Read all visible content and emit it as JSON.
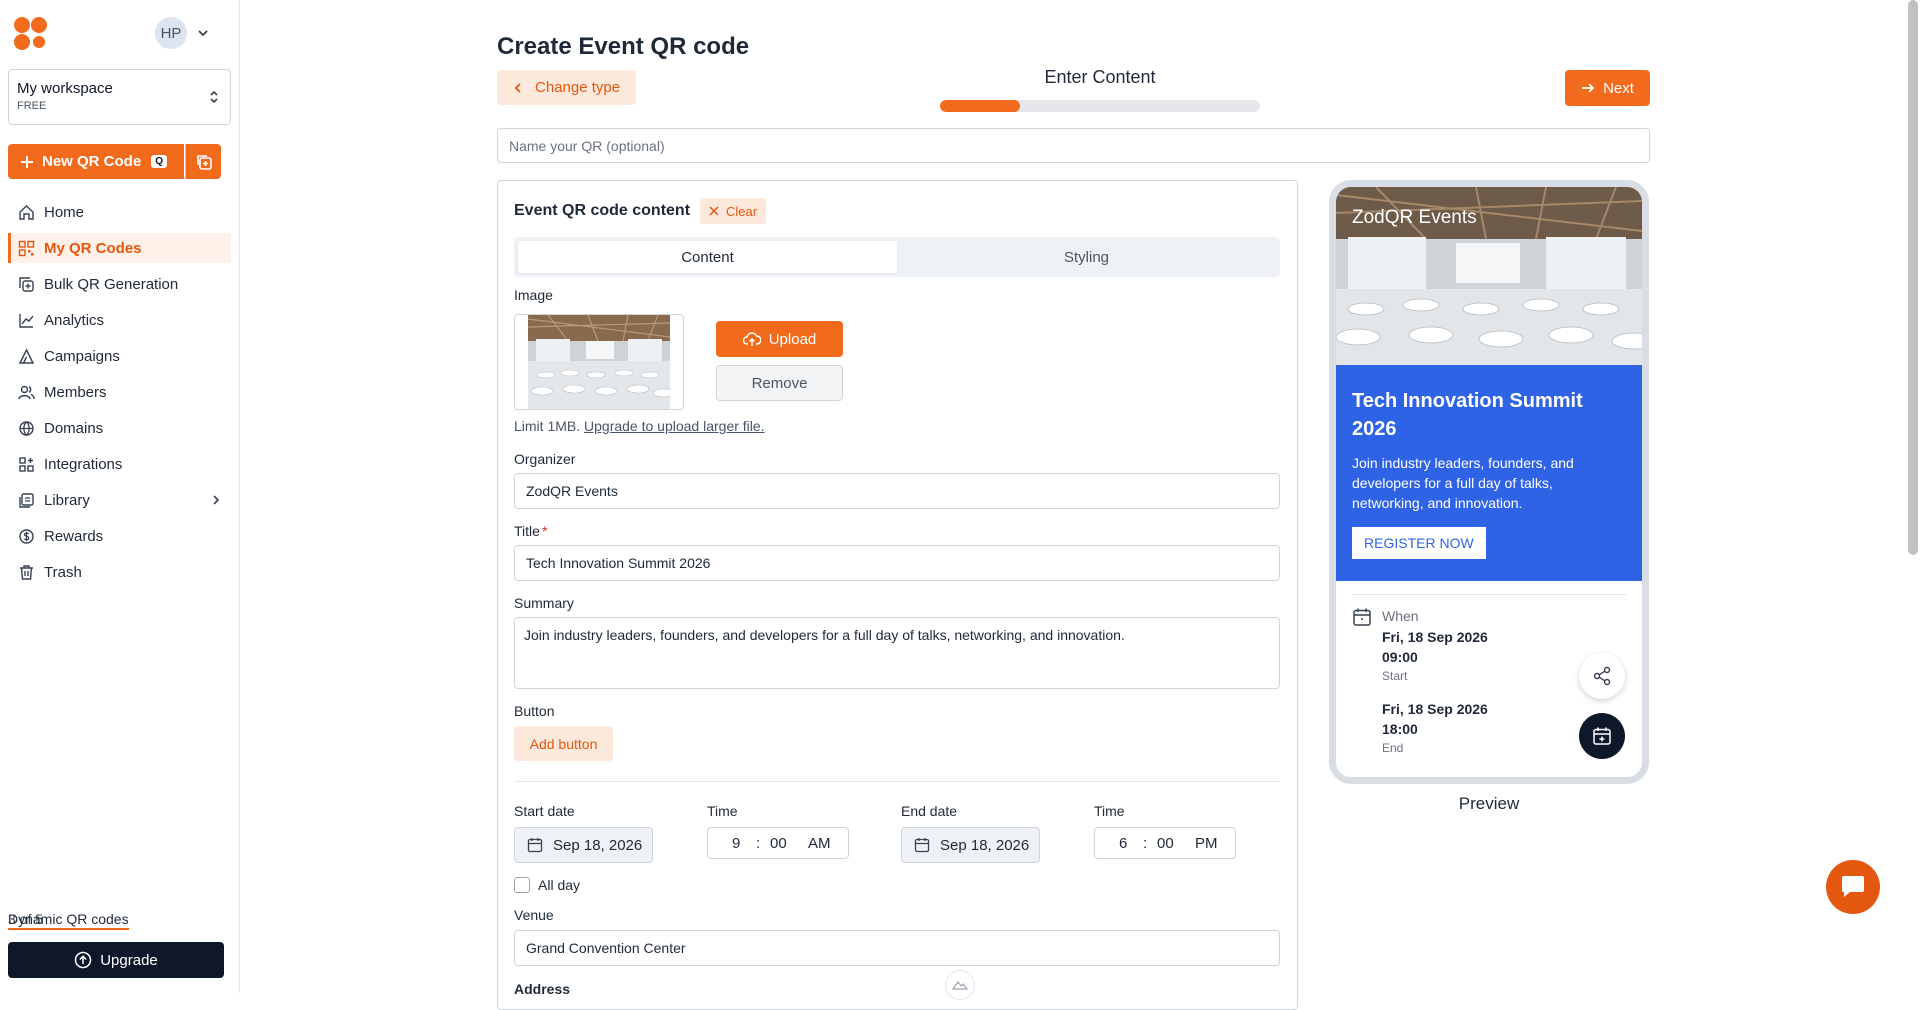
{
  "sidebar": {
    "avatar_initials": "HP",
    "workspace": {
      "name": "My workspace",
      "plan": "FREE"
    },
    "new_qr": {
      "label": "New QR Code",
      "shortcut": "Q"
    },
    "items": [
      {
        "label": "Home",
        "icon": "home-icon"
      },
      {
        "label": "My QR Codes",
        "icon": "qr-grid-icon",
        "active": true
      },
      {
        "label": "Bulk QR Generation",
        "icon": "bulk-copy-icon"
      },
      {
        "label": "Analytics",
        "icon": "analytics-icon"
      },
      {
        "label": "Campaigns",
        "icon": "campaign-icon"
      },
      {
        "label": "Members",
        "icon": "members-icon"
      },
      {
        "label": "Domains",
        "icon": "globe-icon"
      },
      {
        "label": "Integrations",
        "icon": "integrations-icon"
      },
      {
        "label": "Library",
        "icon": "library-icon",
        "has_submenu": true
      },
      {
        "label": "Rewards",
        "icon": "dollar-icon"
      },
      {
        "label": "Trash",
        "icon": "trash-icon"
      }
    ],
    "usage": {
      "label": "Dynamic QR codes",
      "value": "3 of 5"
    },
    "upgrade_label": "Upgrade"
  },
  "header": {
    "title": "Create Event QR code",
    "change_type_label": "Change type",
    "step_label": "Enter Content",
    "progress_fraction": 0.25,
    "next_label": "Next",
    "name_placeholder": "Name your QR (optional)",
    "name_value": ""
  },
  "form": {
    "title": "Event QR code content",
    "clear_label": "Clear",
    "tabs": [
      "Content",
      "Styling"
    ],
    "active_tab": "Content",
    "image_label": "Image",
    "upload_label": "Upload",
    "remove_label": "Remove",
    "limit_text": "Limit 1MB.",
    "limit_link": "Upgrade to upload larger file.",
    "organizer_label": "Organizer",
    "organizer_value": "ZodQR Events",
    "title_label": "Title",
    "title_required": "*",
    "title_value": "Tech Innovation Summit 2026",
    "summary_label": "Summary",
    "summary_value": "Join industry leaders, founders, and developers for a full day of talks, networking, and innovation.",
    "button_label": "Button",
    "add_button_label": "Add button",
    "start_date_label": "Start date",
    "start_date_value": "Sep 18, 2026",
    "start_time_label": "Time",
    "start_time": {
      "hour": "9",
      "sep": ":",
      "minute": "00",
      "ampm": "AM"
    },
    "end_date_label": "End date",
    "end_date_value": "Sep 18, 2026",
    "end_time_label": "Time",
    "end_time": {
      "hour": "6",
      "sep": ":",
      "minute": "00",
      "ampm": "PM"
    },
    "all_day_label": "All day",
    "all_day_checked": false,
    "venue_label": "Venue",
    "venue_value": "Grand Convention Center",
    "address_label": "Address"
  },
  "preview": {
    "brand": "ZodQR Events",
    "title": "Tech Innovation Summit 2026",
    "summary": "Join industry leaders, founders, and developers for a full day of talks, networking, and innovation.",
    "register_label": "REGISTER NOW",
    "when_label": "When",
    "start_date": "Fri, 18 Sep 2026",
    "start_time": "09:00",
    "start_label": "Start",
    "end_date": "Fri, 18 Sep 2026",
    "end_time": "18:00",
    "end_label": "End",
    "caption": "Preview",
    "accent_color": "#2f63e6"
  },
  "colors": {
    "brand": "#f26b1d",
    "brand_soft": "#fde9dc",
    "dark": "#0f172a"
  }
}
